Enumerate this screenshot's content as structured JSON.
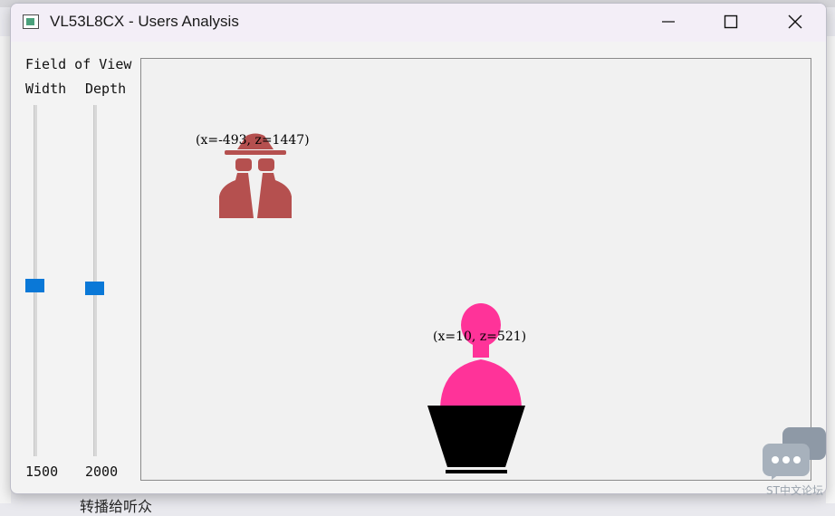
{
  "window": {
    "title": "VL53L8CX - Users Analysis"
  },
  "controls": {
    "field_of_view_label": "Field of View",
    "width_label": "Width",
    "depth_label": "Depth",
    "width_value": "1500",
    "depth_value": "2000",
    "width_slider_fraction": 0.52,
    "depth_slider_fraction": 0.52
  },
  "users": [
    {
      "coord_label": "(x=-493, z=1447)",
      "icon": "incognito-user-icon",
      "color": "#b5504f"
    },
    {
      "coord_label": "(x=10, z=521)",
      "icon": "user-icon",
      "color": "#ff3399"
    }
  ],
  "podium": {
    "icon": "podium-icon",
    "color": "#000000"
  },
  "accent_color": "#0a78d7",
  "background_fragments": {
    "watermark": "ST中文论坛",
    "bottom_text": "转播给听众"
  }
}
